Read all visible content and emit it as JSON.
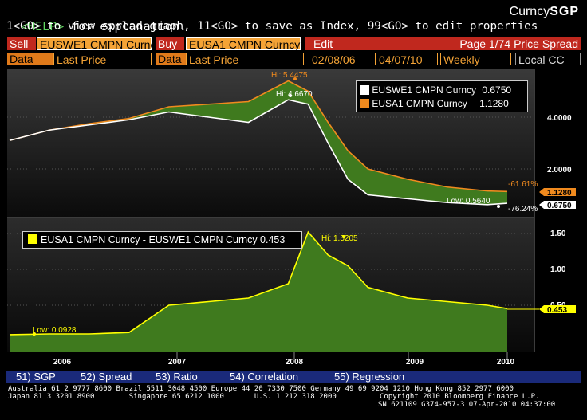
{
  "header": {
    "line1_help_key": "<HELP>",
    "line1_rest": " for explanation.",
    "brand_prefix": "Curncy",
    "brand_code": "SGP",
    "line2": "1<GO> to view spread graph, 11<GO> to save as Index, 99<GO> to edit properties"
  },
  "toolbar": {
    "sell_label": "Sell",
    "sell_ticker": "EUSWE1 CMPN Curncy",
    "buy_label": "Buy",
    "buy_ticker": "EUSA1 CMPN Curncy",
    "edit_label": "Edit",
    "page_info": "Page 1/74  Price Spread",
    "data_label1": "Data",
    "data_value1": "Last Price",
    "data_label2": "Data",
    "data_value2": "Last Price",
    "start_date": "02/08/06",
    "end_date": "04/07/10",
    "period": "Weekly",
    "currency": "Local CC"
  },
  "colors": {
    "accent_amber": "#f4a336",
    "sell_red": "#c0281e",
    "series_white": "#ffffff",
    "series_orange": "#f08a1e",
    "spread_yellow": "#ffff00",
    "fill_green": "#3f7a1e",
    "nav_blue": "#1a2a7a"
  },
  "upper_chart": {
    "legend": [
      {
        "name": "EUSWE1 CMPN Curncy",
        "last": "0.6750",
        "color": "#ffffff"
      },
      {
        "name": "EUSA1 CMPN Curncy",
        "last": "1.1280",
        "color": "#f08a1e"
      }
    ],
    "hi_orange": "Hi: 5.4475",
    "hi_white": "Hi: 4.6670",
    "low_white": "Low: 0.5640",
    "pct_orange": "-61.61%",
    "pct_white": "-76.24%",
    "y_ticks": [
      "4.0000",
      "2.0000"
    ],
    "last_orange": "1.1280",
    "last_white": "0.6750"
  },
  "lower_chart": {
    "legend": "EUSA1 CMPN Curncy - EUSWE1 CMPN Curncy 0.453",
    "hi": "Hi: 1.5205",
    "low": "Low: 0.0928",
    "y_ticks": [
      "1.50",
      "1.00",
      "0.50"
    ],
    "last": "0.453"
  },
  "x_axis": {
    "labels": [
      "2006",
      "2007",
      "2008",
      "2009",
      "2010"
    ]
  },
  "nav": {
    "items": [
      "51) SGP",
      "52) Spread",
      "53) Ratio",
      "54) Correlation",
      "55) Regression"
    ]
  },
  "footer": {
    "line1": "Australia 61 2 9777 8600 Brazil 5511 3048 4500 Europe 44 20 7330 7500 Germany 49 69 9204 1210 Hong Kong 852 2977 6000",
    "line2": "Japan 81 3 3201 8900        Singapore 65 6212 1000       U.S. 1 212 318 2000          Copyright 2010 Bloomberg Finance L.P.",
    "line3": "SN 621109 G374-957-3 07-Apr-2010 04:37:00"
  },
  "chart_data": [
    {
      "type": "line",
      "title": "",
      "x": [
        "2006-02",
        "2006-06",
        "2006-10",
        "2007-02",
        "2007-06",
        "2007-10",
        "2008-02",
        "2008-06",
        "2008-08",
        "2008-10",
        "2008-12",
        "2009-02",
        "2009-06",
        "2009-10",
        "2010-02",
        "2010-04"
      ],
      "series": [
        {
          "name": "EUSWE1 CMPN Curncy",
          "values": [
            3.1,
            3.5,
            3.7,
            3.9,
            4.2,
            4.0,
            3.8,
            4.67,
            4.5,
            3.0,
            1.6,
            1.0,
            0.85,
            0.7,
            0.62,
            0.675
          ]
        },
        {
          "name": "EUSA1 CMPN Curncy",
          "values": [
            3.1,
            3.5,
            3.75,
            3.95,
            4.4,
            4.5,
            4.6,
            5.4,
            5.0,
            3.8,
            2.7,
            2.0,
            1.6,
            1.3,
            1.15,
            1.128
          ]
        }
      ],
      "y_ticks": [
        2.0,
        4.0
      ]
    },
    {
      "type": "area",
      "title": "",
      "x": [
        "2006-02",
        "2006-06",
        "2006-10",
        "2007-02",
        "2007-06",
        "2007-10",
        "2008-02",
        "2008-06",
        "2008-08",
        "2008-10",
        "2008-12",
        "2009-02",
        "2009-06",
        "2009-10",
        "2010-02",
        "2010-04"
      ],
      "series": [
        {
          "name": "EUSA1 CMPN Curncy - EUSWE1 CMPN Curncy",
          "values": [
            0.09,
            0.1,
            0.1,
            0.12,
            0.5,
            0.55,
            0.6,
            0.8,
            1.52,
            1.2,
            1.05,
            0.75,
            0.6,
            0.55,
            0.5,
            0.453
          ]
        }
      ],
      "y_ticks": [
        0.5,
        1.0,
        1.5
      ]
    }
  ]
}
